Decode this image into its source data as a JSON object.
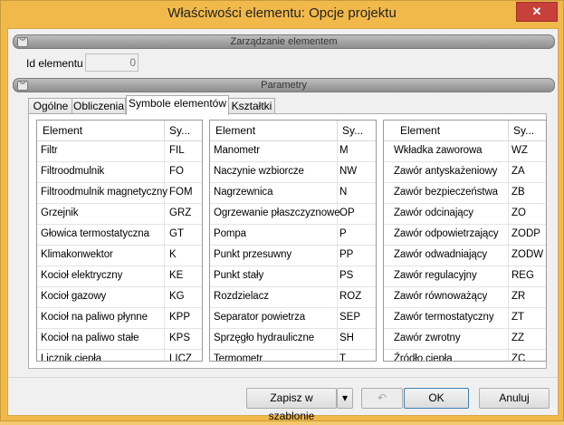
{
  "window": {
    "title": "Właściwości elementu: Opcje projektu",
    "close": "✕"
  },
  "section_manage": {
    "label": "Zarządzanie elementem",
    "chevron": "︾"
  },
  "id_field": {
    "label": "Id elementu",
    "value": "0"
  },
  "section_params": {
    "label": "Parametry",
    "chevron": "︾"
  },
  "tabs": [
    {
      "label": "Ogólne"
    },
    {
      "label": "Obliczenia"
    },
    {
      "label": "Symbole elementów"
    },
    {
      "label": "Kształtki"
    }
  ],
  "grids": [
    {
      "col_element": "Element",
      "col_symbol": "Sy...",
      "rows": [
        [
          "Filtr",
          "FIL"
        ],
        [
          "Filtroodmulnik",
          "FO"
        ],
        [
          "Filtroodmulnik magnetyczny",
          "FOM"
        ],
        [
          "Grzejnik",
          "GRZ"
        ],
        [
          "Głowica termostatyczna",
          "GT"
        ],
        [
          "Klimakonwektor",
          "K"
        ],
        [
          "Kocioł elektryczny",
          "KE"
        ],
        [
          "Kocioł gazowy",
          "KG"
        ],
        [
          "Kocioł na paliwo płynne",
          "KPP"
        ],
        [
          "Kocioł na paliwo stałe",
          "KPS"
        ],
        [
          "Licznik ciepła",
          "LICZ"
        ]
      ]
    },
    {
      "col_element": "Element",
      "col_symbol": "Sy...",
      "rows": [
        [
          "Manometr",
          "M"
        ],
        [
          "Naczynie wzbiorcze",
          "NW"
        ],
        [
          "Nagrzewnica",
          "N"
        ],
        [
          "Ogrzewanie płaszczyznowe",
          "OP"
        ],
        [
          "Pompa",
          "P"
        ],
        [
          "Punkt przesuwny",
          "PP"
        ],
        [
          "Punkt stały",
          "PS"
        ],
        [
          "Rozdzielacz",
          "ROZ"
        ],
        [
          "Separator powietrza",
          "SEP"
        ],
        [
          "Sprzęgło hydrauliczne",
          "SH"
        ],
        [
          "Termometr",
          "T"
        ]
      ]
    },
    {
      "col_element": "Element",
      "col_symbol": "Sy...",
      "rows": [
        [
          "Wkładka zaworowa",
          "WZ"
        ],
        [
          "Zawór antyskażeniowy",
          "ZA"
        ],
        [
          "Zawór bezpieczeństwa",
          "ZB"
        ],
        [
          "Zawór odcinający",
          "ZO"
        ],
        [
          "Zawór odpowietrzający",
          "ZODP"
        ],
        [
          "Zawór odwadniający",
          "ZODW"
        ],
        [
          "Zawór regulacyjny",
          "REG"
        ],
        [
          "Zawór równoważący",
          "ZR"
        ],
        [
          "Zawór termostatyczny",
          "ZT"
        ],
        [
          "Zawór zwrotny",
          "ZZ"
        ],
        [
          "Źródło ciepła",
          "ZC"
        ]
      ]
    }
  ],
  "buttons": {
    "save_template": "Zapisz w szablonie",
    "dropdown": "▾",
    "undo_icon": "↶",
    "ok": "OK",
    "cancel": "Anuluj"
  }
}
